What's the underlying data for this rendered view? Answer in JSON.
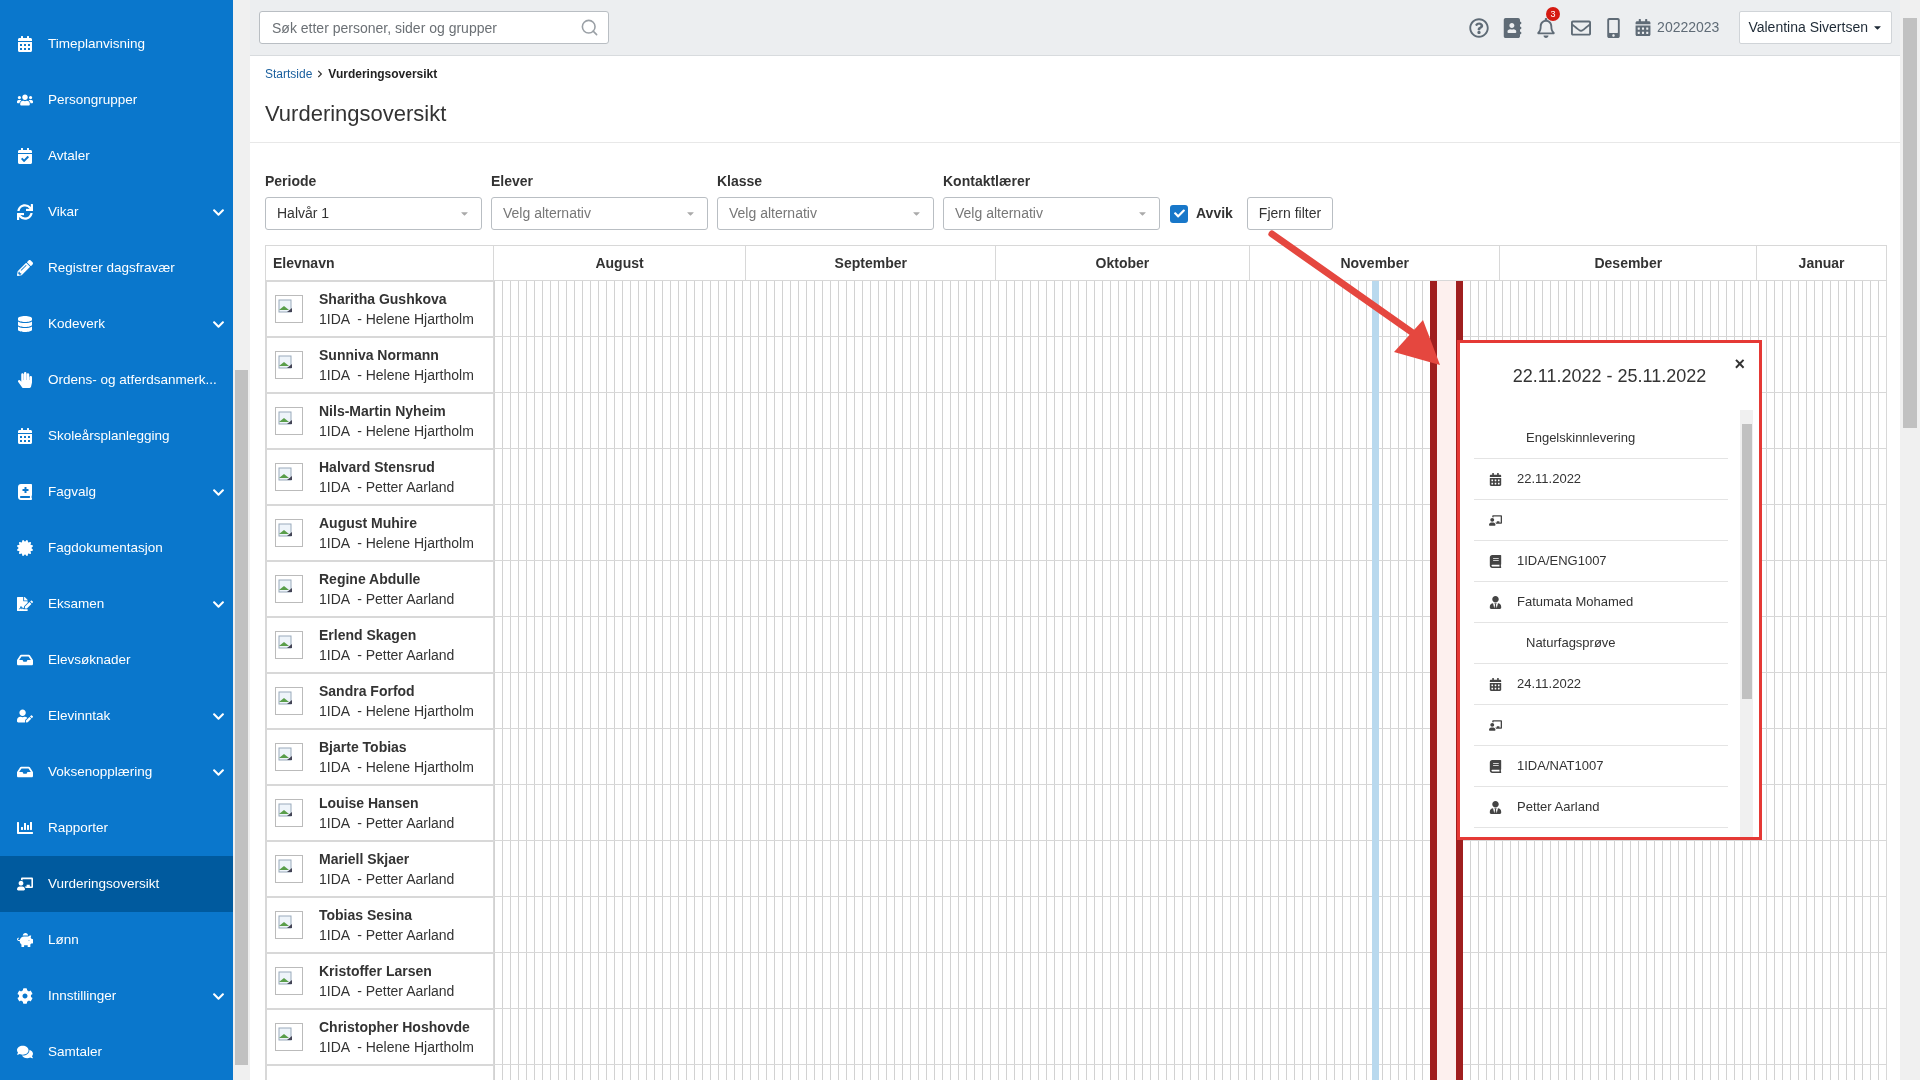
{
  "sidebar": {
    "items": [
      {
        "label": "Timeplanvisning",
        "expandable": false,
        "selected": false
      },
      {
        "label": "Persongrupper",
        "expandable": false,
        "selected": false
      },
      {
        "label": "Avtaler",
        "expandable": false,
        "selected": false
      },
      {
        "label": "Vikar",
        "expandable": true,
        "selected": false
      },
      {
        "label": "Registrer dagsfravær",
        "expandable": false,
        "selected": false
      },
      {
        "label": "Kodeverk",
        "expandable": true,
        "selected": false
      },
      {
        "label": "Ordens- og atferdsanmerk...",
        "expandable": false,
        "selected": false
      },
      {
        "label": "Skoleårsplanlegging",
        "expandable": false,
        "selected": false
      },
      {
        "label": "Fagvalg",
        "expandable": true,
        "selected": false
      },
      {
        "label": "Fagdokumentasjon",
        "expandable": false,
        "selected": false
      },
      {
        "label": "Eksamen",
        "expandable": true,
        "selected": false
      },
      {
        "label": "Elevsøknader",
        "expandable": false,
        "selected": false
      },
      {
        "label": "Elevinntak",
        "expandable": true,
        "selected": false
      },
      {
        "label": "Voksenopplæring",
        "expandable": true,
        "selected": false
      },
      {
        "label": "Rapporter",
        "expandable": false,
        "selected": false
      },
      {
        "label": "Vurderingsoversikt",
        "expandable": false,
        "selected": true
      },
      {
        "label": "Lønn",
        "expandable": false,
        "selected": false
      },
      {
        "label": "Innstillinger",
        "expandable": true,
        "selected": false
      },
      {
        "label": "Samtaler",
        "expandable": false,
        "selected": false
      }
    ]
  },
  "header": {
    "search": {
      "placeholder": "Søk etter personer, sider og grupper"
    },
    "notifications": "3",
    "school_year": "20222023",
    "user": "Valentina Sivertsen"
  },
  "breadcrumb": [
    {
      "label": "Startside",
      "kind": "link"
    },
    {
      "label": "Vurderingsoversikt",
      "kind": "current"
    }
  ],
  "title": "Vurderingsoversikt",
  "filters": [
    {
      "label": "Periode",
      "value": "Halvår 1"
    },
    {
      "label": "Elever",
      "placeholder": "Velg alternativ"
    },
    {
      "label": "Klasse",
      "placeholder": "Velg alternativ"
    },
    {
      "label": "Kontaktlærer",
      "placeholder": "Velg alternativ"
    }
  ],
  "deviation_filter": {
    "label": "Avvik",
    "checked": true
  },
  "clear_button": "Fjern filter",
  "table": {
    "name_column": "Elevnavn",
    "months": [
      "August",
      "September",
      "Oktober",
      "November",
      "Desember",
      "Januar"
    ],
    "rows": [
      {
        "name": "Sharitha Gushkova",
        "detail": "1IDA  - Helene Hjartholm"
      },
      {
        "name": "Sunniva Normann",
        "detail": "1IDA  - Helene Hjartholm"
      },
      {
        "name": "Nils-Martin Nyheim",
        "detail": "1IDA  - Helene Hjartholm"
      },
      {
        "name": "Halvard Stensrud",
        "detail": "1IDA  - Petter Aarland"
      },
      {
        "name": "August Muhire",
        "detail": "1IDA  - Helene Hjartholm"
      },
      {
        "name": "Regine Abdulle",
        "detail": "1IDA  - Petter Aarland"
      },
      {
        "name": "Erlend Skagen",
        "detail": "1IDA  - Petter Aarland"
      },
      {
        "name": "Sandra Forfod",
        "detail": "1IDA  - Helene Hjartholm"
      },
      {
        "name": "Bjarte Tobias",
        "detail": "1IDA  - Helene Hjartholm"
      },
      {
        "name": "Louise Hansen",
        "detail": "1IDA  - Petter Aarland"
      },
      {
        "name": "Mariell Skjaer",
        "detail": "1IDA  - Petter Aarland"
      },
      {
        "name": "Tobias Sesina",
        "detail": "1IDA  - Petter Aarland"
      },
      {
        "name": "Kristoffer Larsen",
        "detail": "1IDA  - Petter Aarland"
      },
      {
        "name": "Christopher Hoshovde",
        "detail": "1IDA  - Helene Hjartholm"
      }
    ]
  },
  "popup": {
    "title": "22.11.2022 - 25.11.2022",
    "close": "×",
    "items": [
      {
        "kind": "title",
        "text": "Engelskinnlevering"
      },
      {
        "kind": "date",
        "text": "22.11.2022"
      },
      {
        "kind": "group"
      },
      {
        "kind": "subject",
        "text": "1IDA/ENG1007"
      },
      {
        "kind": "teacher",
        "text": "Fatumata Mohamed"
      },
      {
        "kind": "title",
        "text": "Naturfagsprøve"
      },
      {
        "kind": "date",
        "text": "24.11.2022"
      },
      {
        "kind": "group"
      },
      {
        "kind": "subject",
        "text": "1IDA/NAT1007"
      },
      {
        "kind": "teacher",
        "text": "Petter Aarland"
      }
    ]
  }
}
